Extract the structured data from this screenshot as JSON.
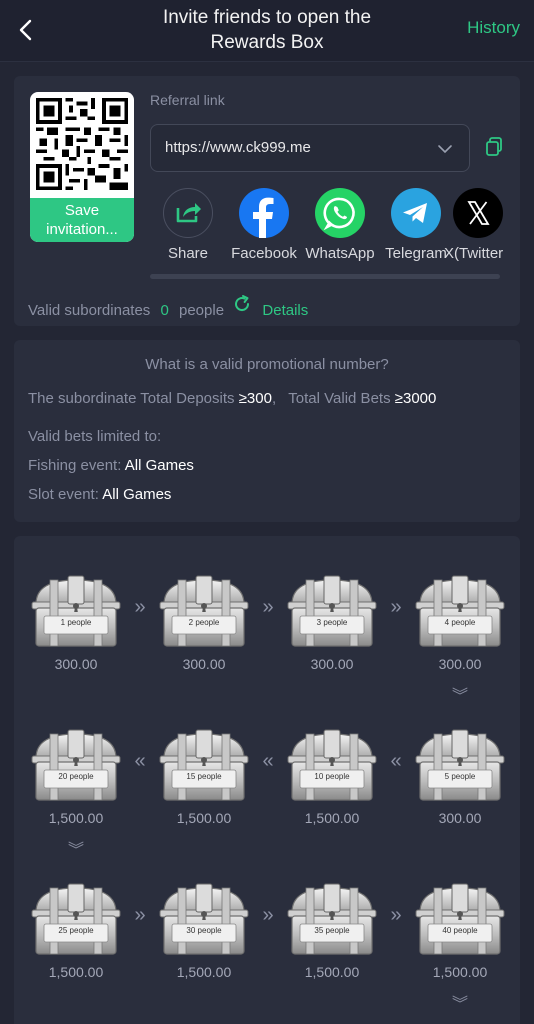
{
  "header": {
    "title_line1": "Invite friends to open the",
    "title_line2": "Rewards Box",
    "history": "History"
  },
  "referral": {
    "label": "Referral link",
    "link": "https://www.ck999.me",
    "save_line1": "Save",
    "save_line2": "invitation...",
    "share_targets": [
      {
        "name": "share",
        "label": "Share",
        "color": "#2a2e3d"
      },
      {
        "name": "facebook",
        "label": "Facebook",
        "color": "#1877f2"
      },
      {
        "name": "whatsapp",
        "label": "WhatsApp",
        "color": "#25d366"
      },
      {
        "name": "telegram",
        "label": "Telegram",
        "color": "#2aa3e0"
      },
      {
        "name": "x",
        "label": "X(Twitter",
        "color": "#000000"
      }
    ],
    "valid_prefix": "Valid subordinates",
    "valid_count": "0",
    "valid_unit": "people",
    "details": "Details"
  },
  "rules": {
    "title": "What is a valid promotional number?",
    "deposit_label": "The subordinate Total Deposits",
    "deposit_value": "≥300",
    "sep": ",",
    "bets_label": "Total Valid Bets",
    "bets_value": "≥3000",
    "limited": "Valid bets limited to:",
    "fishing_label": "Fishing event:",
    "fishing_value": "All Games",
    "slot_label": "Slot event:",
    "slot_value": "All Games"
  },
  "boxes": [
    {
      "people": "1 people",
      "amount": "300.00"
    },
    {
      "people": "2 people",
      "amount": "300.00"
    },
    {
      "people": "3 people",
      "amount": "300.00"
    },
    {
      "people": "4 people",
      "amount": "300.00"
    },
    {
      "people": "5 people",
      "amount": "300.00"
    },
    {
      "people": "10 people",
      "amount": "1,500.00"
    },
    {
      "people": "15 people",
      "amount": "1,500.00"
    },
    {
      "people": "20 people",
      "amount": "1,500.00"
    },
    {
      "people": "25 people",
      "amount": "1,500.00"
    },
    {
      "people": "30 people",
      "amount": "1,500.00"
    },
    {
      "people": "35 people",
      "amount": "1,500.00"
    },
    {
      "people": "40 people",
      "amount": "1,500.00"
    }
  ],
  "arrows": {
    "right": "»",
    "left": "«",
    "down": "︾"
  },
  "colors": {
    "accent": "#2ec784",
    "bg": "#232634",
    "card": "#2a2e3d"
  }
}
